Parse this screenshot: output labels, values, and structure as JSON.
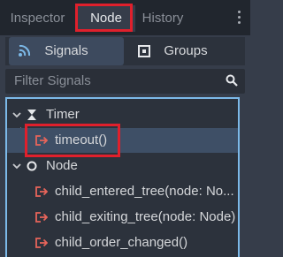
{
  "tabs": {
    "inspector": "Inspector",
    "node": "Node",
    "history": "History"
  },
  "segments": {
    "signals": "Signals",
    "groups": "Groups"
  },
  "filter": {
    "placeholder": "Filter Signals"
  },
  "tree": {
    "timer_label": "Timer",
    "timer_signals": [
      "timeout()"
    ],
    "node_label": "Node",
    "node_signals": [
      "child_entered_tree(node: No...",
      "child_exiting_tree(node: Node)",
      "child_order_changed()"
    ]
  },
  "colors": {
    "highlight": "#e0202c",
    "signal_icon": "#e8645a",
    "accent": "#7cb9e8"
  }
}
